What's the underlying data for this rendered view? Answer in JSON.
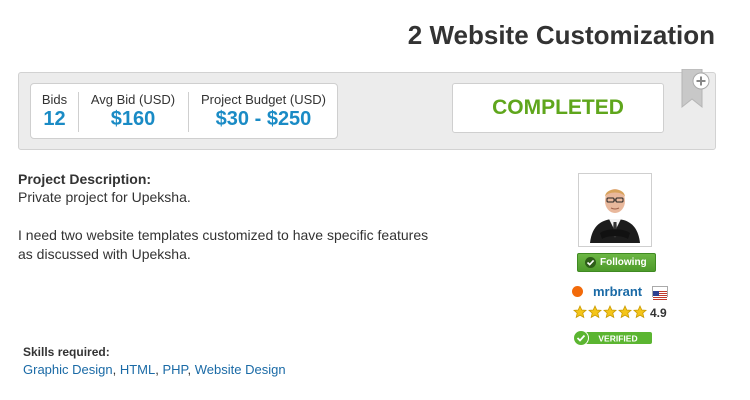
{
  "project": {
    "title": "2 Website Customization",
    "stats": {
      "bids_label": "Bids",
      "bids_value": "12",
      "avg_label": "Avg Bid (USD)",
      "avg_value": "$160",
      "budget_label": "Project Budget (USD)",
      "budget_value": "$30 - $250"
    },
    "status": "COMPLETED",
    "description": {
      "heading": "Project Description:",
      "line1": "Private project for Upeksha.",
      "line2": "I need two website templates customized to have specific features",
      "line3": "as discussed with Upeksha."
    },
    "skills_heading": "Skills required:",
    "skills": [
      "Graphic Design",
      "HTML",
      "PHP",
      "Website Design"
    ]
  },
  "employer": {
    "follow_label": "Following",
    "username": "mrbrant",
    "rating": "4.9",
    "stars": 5,
    "verified_label": "VERIFIED",
    "online_color": "#f26a0a"
  },
  "colors": {
    "accent": "#1a8bc5",
    "completed": "#5fa61c",
    "link": "#1a6aa6"
  },
  "icons": [
    "bookmark-add-icon",
    "check-icon",
    "us-flag-icon",
    "star-icon",
    "verified-badge-icon",
    "online-status-icon"
  ]
}
